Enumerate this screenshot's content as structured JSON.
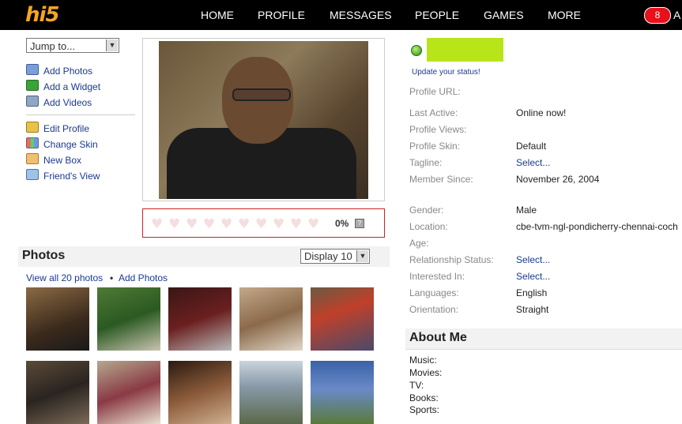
{
  "brand": {
    "logo": "hi5"
  },
  "nav": {
    "items": [
      "HOME",
      "PROFILE",
      "MESSAGES",
      "PEOPLE",
      "GAMES",
      "MORE"
    ],
    "notifications": "8",
    "trailing": "A"
  },
  "left": {
    "jump_label": "Jump to...",
    "links": [
      "Add Photos",
      "Add a Widget",
      "Add Videos",
      "Edit Profile",
      "Change Skin",
      "New Box",
      "Friend's View"
    ]
  },
  "rating": {
    "percent": "0%",
    "hearts": 10,
    "help": "?"
  },
  "photos": {
    "title": "Photos",
    "display_label": "Display 10",
    "view_all": "View all 20 photos",
    "bullet": "•",
    "add_photos": "Add Photos"
  },
  "profile": {
    "update_status": "Update your status!",
    "fields": [
      {
        "label": "Profile URL:",
        "value": ""
      },
      {
        "label": "Last Active:",
        "value": "Online now!"
      },
      {
        "label": "Profile Views:",
        "value": ""
      },
      {
        "label": "Profile Skin:",
        "value": "Default"
      },
      {
        "label": "Tagline:",
        "value": "Select..."
      },
      {
        "label": "Member Since:",
        "value": "November 26, 2004"
      },
      {
        "label": "Gender:",
        "value": "Male"
      },
      {
        "label": "Location:",
        "value": "cbe-tvm-ngl-pondicherry-chennai-coch"
      },
      {
        "label": "Age:",
        "value": ""
      },
      {
        "label": "Relationship Status:",
        "value": "Select..."
      },
      {
        "label": "Interested In:",
        "value": "Select..."
      },
      {
        "label": "Languages:",
        "value": "English"
      },
      {
        "label": "Orientation:",
        "value": "Straight"
      }
    ]
  },
  "about": {
    "title": "About Me",
    "fields": [
      "Music:",
      "Movies:",
      "TV:",
      "Books:",
      "Sports:"
    ]
  },
  "colors": {
    "topbar": "#000000",
    "logo": "#f5a623",
    "link": "#1a3a8f",
    "status_name_box": "#b8e41a",
    "rating_border": "#cc2222",
    "notif": "#e8101a"
  }
}
